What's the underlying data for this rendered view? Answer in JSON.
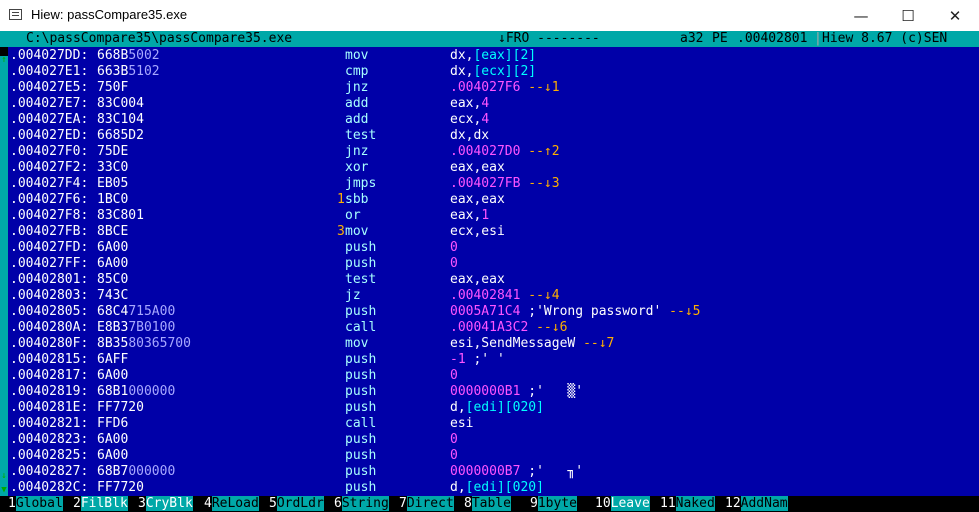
{
  "window": {
    "title": "Hiew: passCompare35.exe",
    "minimize_glyph": "—",
    "maximize_glyph": "☐",
    "close_glyph": "✕"
  },
  "status": {
    "path": "C:\\passCompare35\\passCompare35.exe",
    "mode": "↓FRO --------",
    "bitness": "a32",
    "format": "PE",
    "offset": ".00402801",
    "version": "Hiew 8.67 (c)SEN"
  },
  "listing": [
    {
      "addr": ".004027DD:",
      "hex": "668B5002",
      "mark": "",
      "mnem": "mov",
      "ops": "dx,[eax][2]"
    },
    {
      "addr": ".004027E1:",
      "hex": "663B5102",
      "mark": "",
      "mnem": "cmp",
      "ops": "dx,[ecx][2]"
    },
    {
      "addr": ".004027E5:",
      "hex": "750F",
      "mark": "",
      "mnem": "jnz",
      "ops": ".004027F6 --↓1"
    },
    {
      "addr": ".004027E7:",
      "hex": "83C004",
      "mark": "",
      "mnem": "add",
      "ops": "eax,4"
    },
    {
      "addr": ".004027EA:",
      "hex": "83C104",
      "mark": "",
      "mnem": "add",
      "ops": "ecx,4"
    },
    {
      "addr": ".004027ED:",
      "hex": "6685D2",
      "mark": "",
      "mnem": "test",
      "ops": "dx,dx"
    },
    {
      "addr": ".004027F0:",
      "hex": "75DE",
      "mark": "",
      "mnem": "jnz",
      "ops": ".004027D0 --↑2"
    },
    {
      "addr": ".004027F2:",
      "hex": "33C0",
      "mark": "",
      "mnem": "xor",
      "ops": "eax,eax"
    },
    {
      "addr": ".004027F4:",
      "hex": "EB05",
      "mark": "",
      "mnem": "jmps",
      "ops": ".004027FB --↓3"
    },
    {
      "addr": ".004027F6:",
      "hex": "1BC0",
      "mark": "1",
      "mnem": "sbb",
      "ops": "eax,eax"
    },
    {
      "addr": ".004027F8:",
      "hex": "83C801",
      "mark": "",
      "mnem": "or",
      "ops": "eax,1"
    },
    {
      "addr": ".004027FB:",
      "hex": "8BCE",
      "mark": "3",
      "mnem": "mov",
      "ops": "ecx,esi"
    },
    {
      "addr": ".004027FD:",
      "hex": "6A00",
      "mark": "",
      "mnem": "push",
      "ops": "0"
    },
    {
      "addr": ".004027FF:",
      "hex": "6A00",
      "mark": "",
      "mnem": "push",
      "ops": "0"
    },
    {
      "addr": ".00402801:",
      "hex": "85C0",
      "mark": "",
      "mnem": "test",
      "ops": "eax,eax"
    },
    {
      "addr": ".00402803:",
      "hex": "743C",
      "mark": "",
      "mnem": "jz",
      "ops": ".00402841 --↓4"
    },
    {
      "addr": ".00402805:",
      "hex": "68C4715A00",
      "mark": "",
      "mnem": "push",
      "ops": "0005A71C4 ;'Wrong password' --↓5"
    },
    {
      "addr": ".0040280A:",
      "hex": "E8B37B0100",
      "mark": "",
      "mnem": "call",
      "ops": ".00041A3C2 --↓6"
    },
    {
      "addr": ".0040280F:",
      "hex": "8B3580365700",
      "mark": "",
      "mnem": "mov",
      "ops": "esi,SendMessageW --↓7"
    },
    {
      "addr": ".00402815:",
      "hex": "6AFF",
      "mark": "",
      "mnem": "push",
      "ops": "-1 ;' '"
    },
    {
      "addr": ".00402817:",
      "hex": "6A00",
      "mark": "",
      "mnem": "push",
      "ops": "0"
    },
    {
      "addr": ".00402819:",
      "hex": "68B1000000",
      "mark": "",
      "mnem": "push",
      "ops": "0000000B1 ;'   ▒'"
    },
    {
      "addr": ".0040281E:",
      "hex": "FF7720",
      "mark": "",
      "mnem": "push",
      "ops": "d,[edi][020]"
    },
    {
      "addr": ".00402821:",
      "hex": "FFD6",
      "mark": "",
      "mnem": "call",
      "ops": "esi"
    },
    {
      "addr": ".00402823:",
      "hex": "6A00",
      "mark": "",
      "mnem": "push",
      "ops": "0"
    },
    {
      "addr": ".00402825:",
      "hex": "6A00",
      "mark": "",
      "mnem": "push",
      "ops": "0"
    },
    {
      "addr": ".00402827:",
      "hex": "68B7000000",
      "mark": "",
      "mnem": "push",
      "ops": "0000000B7 ;'   ╖'"
    },
    {
      "addr": ".0040282C:",
      "hex": "FF7720",
      "mark": "",
      "mnem": "push",
      "ops": "d,[edi][020]"
    }
  ],
  "fkeys": [
    {
      "num": "1",
      "label": "Global"
    },
    {
      "num": "2",
      "label": "FilBlk"
    },
    {
      "num": "3",
      "label": "CryBlk"
    },
    {
      "num": "4",
      "label": "ReLoad"
    },
    {
      "num": "5",
      "label": "OrdLdr"
    },
    {
      "num": "6",
      "label": "String"
    },
    {
      "num": "7",
      "label": "Direct"
    },
    {
      "num": "8",
      "label": "Table"
    },
    {
      "num": "9",
      "label": "1byte"
    },
    {
      "num": "10",
      "label": "Leave"
    },
    {
      "num": "11",
      "label": "Naked"
    },
    {
      "num": "12",
      "label": "AddNam"
    }
  ],
  "scrollbar": {
    "up_glyph": "↑",
    "down_glyph": "↓",
    "down_arrow_glyph": "▼",
    "position": 0
  }
}
